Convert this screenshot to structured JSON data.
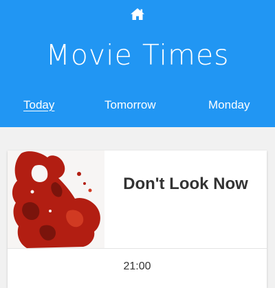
{
  "header": {
    "home_icon": "home-icon",
    "title": "Movie Times",
    "background": "#2196f3"
  },
  "days": [
    {
      "label": "Today",
      "active": true
    },
    {
      "label": "Tomorrow",
      "active": false
    },
    {
      "label": "Monday",
      "active": false
    }
  ],
  "movie": {
    "title": "Don't Look Now",
    "poster_accent": "#b21e12",
    "showtimes": [
      "21:00"
    ]
  }
}
